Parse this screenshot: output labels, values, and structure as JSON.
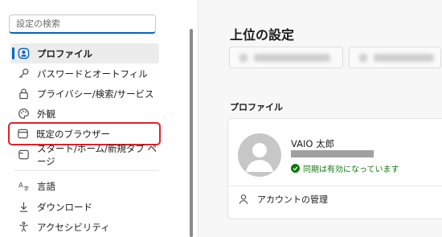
{
  "sidebar": {
    "search_placeholder": "設定の検索",
    "items": [
      {
        "label": "プロファイル"
      },
      {
        "label": "パスワードとオートフィル"
      },
      {
        "label": "プライバシー/検索/サービス"
      },
      {
        "label": "外観"
      },
      {
        "label": "既定のブラウザー"
      },
      {
        "label": "スタート/ホーム/新規タブ ページ"
      },
      {
        "label": "言語"
      },
      {
        "label": "ダウンロード"
      },
      {
        "label": "アクセシビリティ"
      }
    ]
  },
  "main": {
    "title": "上位の設定",
    "section_title": "プロファイル",
    "profile": {
      "name": "VAIO 太郎",
      "sync_status": "同期は有効になっています"
    },
    "manage_accounts": "アカウントの管理"
  },
  "colors": {
    "accent": "#0067c0",
    "sync_green": "#0f7b0f",
    "highlight_red": "#e0212b"
  }
}
